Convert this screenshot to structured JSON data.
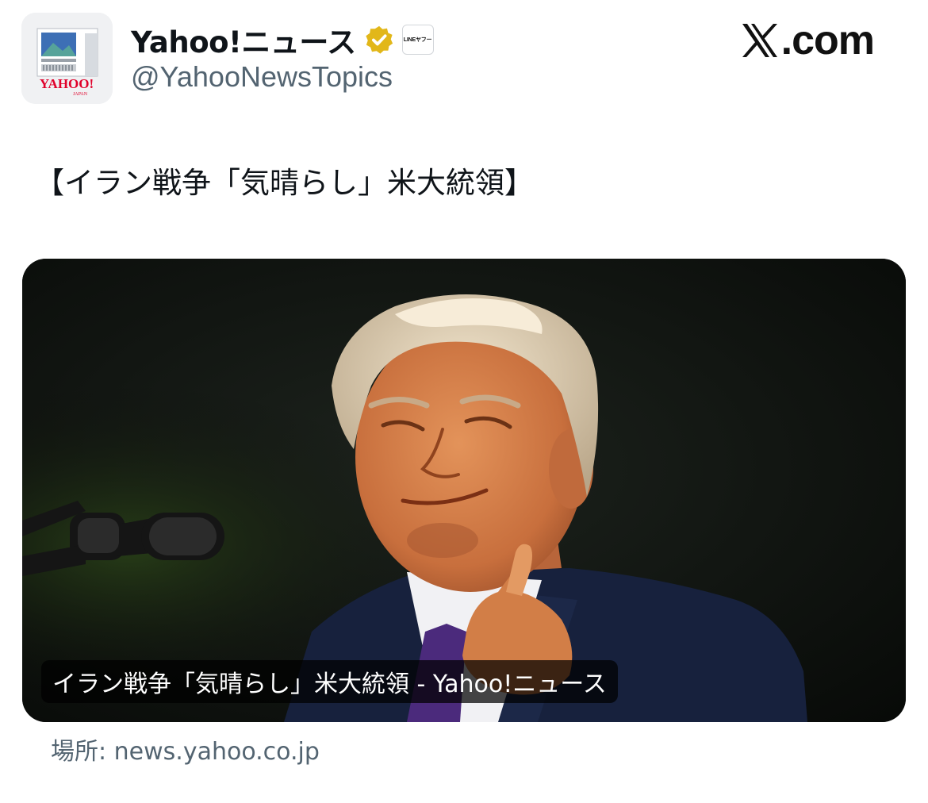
{
  "header": {
    "display_name": "Yahoo!ニュース",
    "handle": "@YahooNewsTopics",
    "affiliate_badge_text": "LINEヤフー",
    "avatar_logo_text": "YAHOO!",
    "avatar_logo_subtext": "JAPAN",
    "verified_icon": "verified-badge-icon",
    "verified_color": "#e2b719"
  },
  "brand": {
    "icon": "x-logo-icon",
    "text": ".com"
  },
  "post": {
    "text": "【イラン戦争「気晴らし」米大統領】"
  },
  "card": {
    "image_icon": "photo-image",
    "caption": "イラン戦争「気晴らし」米大統領 - Yahoo!ニュース"
  },
  "source": {
    "text": "場所: news.yahoo.co.jp"
  }
}
